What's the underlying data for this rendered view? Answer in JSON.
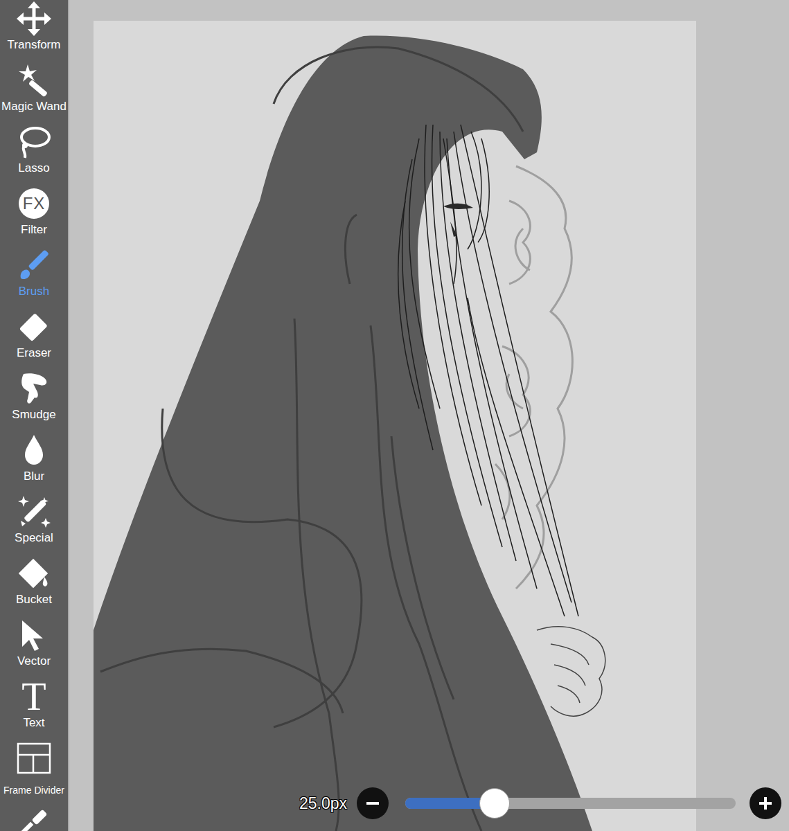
{
  "tools": [
    {
      "label": "Transform",
      "selected": false
    },
    {
      "label": "Magic Wand",
      "selected": false
    },
    {
      "label": "Lasso",
      "selected": false
    },
    {
      "label": "Filter",
      "selected": false,
      "icon_text": "FX"
    },
    {
      "label": "Brush",
      "selected": true
    },
    {
      "label": "Eraser",
      "selected": false
    },
    {
      "label": "Smudge",
      "selected": false
    },
    {
      "label": "Blur",
      "selected": false
    },
    {
      "label": "Special",
      "selected": false
    },
    {
      "label": "Bucket",
      "selected": false
    },
    {
      "label": "Vector",
      "selected": false
    },
    {
      "label": "Text",
      "selected": false,
      "icon_text": "T"
    },
    {
      "label": "Frame Divider",
      "selected": false
    }
  ],
  "brush_size": {
    "reading": "25.0px",
    "level": 0.27
  }
}
